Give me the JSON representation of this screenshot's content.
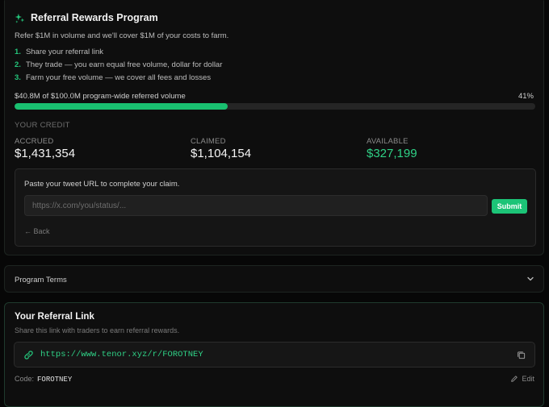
{
  "program": {
    "title": "Referral Rewards Program",
    "description": "Refer $1M in volume and we'll cover $1M of your costs to farm.",
    "steps": [
      {
        "num": "1.",
        "text": "Share your referral link"
      },
      {
        "num": "2.",
        "text": "They trade — you earn equal free volume, dollar for dollar"
      },
      {
        "num": "3.",
        "text": "Farm your free volume — we cover all fees and losses"
      }
    ],
    "progress_label": "$40.8M of $100.0M program-wide referred volume",
    "progress_percent_label": "41%",
    "progress_fraction": 0.41
  },
  "credit": {
    "section_label": "YOUR CREDIT",
    "accrued_label": "ACCRUED",
    "accrued_value": "$1,431,354",
    "claimed_label": "CLAIMED",
    "claimed_value": "$1,104,154",
    "available_label": "AVAILABLE",
    "available_value": "$327,199"
  },
  "claim": {
    "prompt": "Paste your tweet URL to complete your claim.",
    "input_placeholder": "https://x.com/you/status/...",
    "input_value": "",
    "submit_label": "Submit",
    "back_label": "← Back"
  },
  "terms": {
    "label": "Program Terms",
    "icon": "chevron-down-icon"
  },
  "referral": {
    "title": "Your Referral Link",
    "subtitle": "Share this link with traders to earn referral rewards.",
    "link": "https://www.tenor.xyz/r/FOROTNEY",
    "code_label": "Code:",
    "code_value": "FOROTNEY",
    "edit_label": "Edit"
  },
  "colors": {
    "accent": "#1cc477",
    "background": "#070707",
    "card": "#0e0e0e"
  },
  "icons": [
    "sparkle-icon",
    "chevron-down-icon",
    "link-icon",
    "copy-icon",
    "pencil-icon"
  ]
}
